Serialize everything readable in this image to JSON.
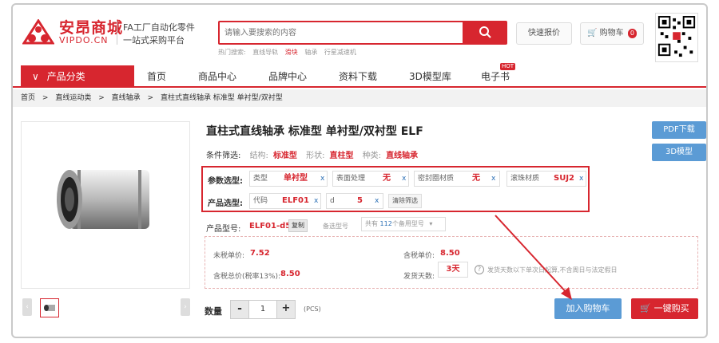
{
  "brand": {
    "name_cn": "安昂商城",
    "name_en": "VIPDO.CN",
    "slogan1": "FA工厂自动化零件",
    "slogan2": "一站式采购平台"
  },
  "search": {
    "placeholder": "请输入要搜索的内容"
  },
  "hot_searches": [
    "热门搜索:",
    "直线导轨",
    "滑块",
    "轴承",
    "行星减速机"
  ],
  "header": {
    "quote_label": "快速报价",
    "cart_label": "购物车",
    "cart_count": "0"
  },
  "nav": {
    "category_label": "产品分类",
    "items": [
      "首页",
      "商品中心",
      "品牌中心",
      "资料下载",
      "3D模型库",
      "电子书"
    ],
    "hot_badge": "HOT"
  },
  "breadcrumb": [
    "首页",
    ">",
    "直线运动类",
    ">",
    "直线轴承",
    ">",
    "直柱式直线轴承 标准型 单衬型/双衬型"
  ],
  "product": {
    "title": "直柱式直线轴承 标准型 单衬型/双衬型  ELF"
  },
  "side_buttons": {
    "pdf": "PDF下载",
    "model3d": "3D模型"
  },
  "filter": {
    "label": "条件筛选:",
    "items": [
      {
        "k": "结构:",
        "v": "标准型"
      },
      {
        "k": "形状:",
        "v": "直柱型"
      },
      {
        "k": "种类:",
        "v": "直线轴承"
      }
    ]
  },
  "params": {
    "row1_label": "参数选型:",
    "row1": [
      {
        "name": "类型",
        "value": "单衬型"
      },
      {
        "name": "表面处理",
        "value": "无"
      },
      {
        "name": "密封圈材质",
        "value": "无"
      },
      {
        "name": "滚珠材质",
        "value": "SUJ2"
      }
    ],
    "row2_label": "产品选型:",
    "row2": [
      {
        "name": "代码",
        "value": "ELF01"
      },
      {
        "name": "d",
        "value": "5"
      }
    ],
    "remove": "x",
    "clear_label": "清除筛选"
  },
  "model": {
    "label": "产品型号:",
    "value": "ELF01-d5",
    "copy_label": "复制",
    "alt_label": "备选型号",
    "alt_prefix": "共有",
    "alt_count": "112",
    "alt_suffix": "个备用型号"
  },
  "price": {
    "untaxed_label": "未税单价:",
    "untaxed_value": "7.52",
    "taxed_label": "含税单价:",
    "taxed_value": "8.50",
    "total_label": "含税总价(税率13%):",
    "total_value": "8.50",
    "ship_label": "发货天数:",
    "ship_value": "3天",
    "ship_tip": "发货天数以下单次日起算,不含周日与法定假日"
  },
  "qty": {
    "label": "数量",
    "value": "1",
    "minus": "-",
    "plus": "+",
    "unit": "(PCS)"
  },
  "actions": {
    "add_cart": "加入购物车",
    "buy_now": "一键购买"
  },
  "colors": {
    "brand_red": "#d7262f",
    "blue": "#5b9bd5"
  }
}
